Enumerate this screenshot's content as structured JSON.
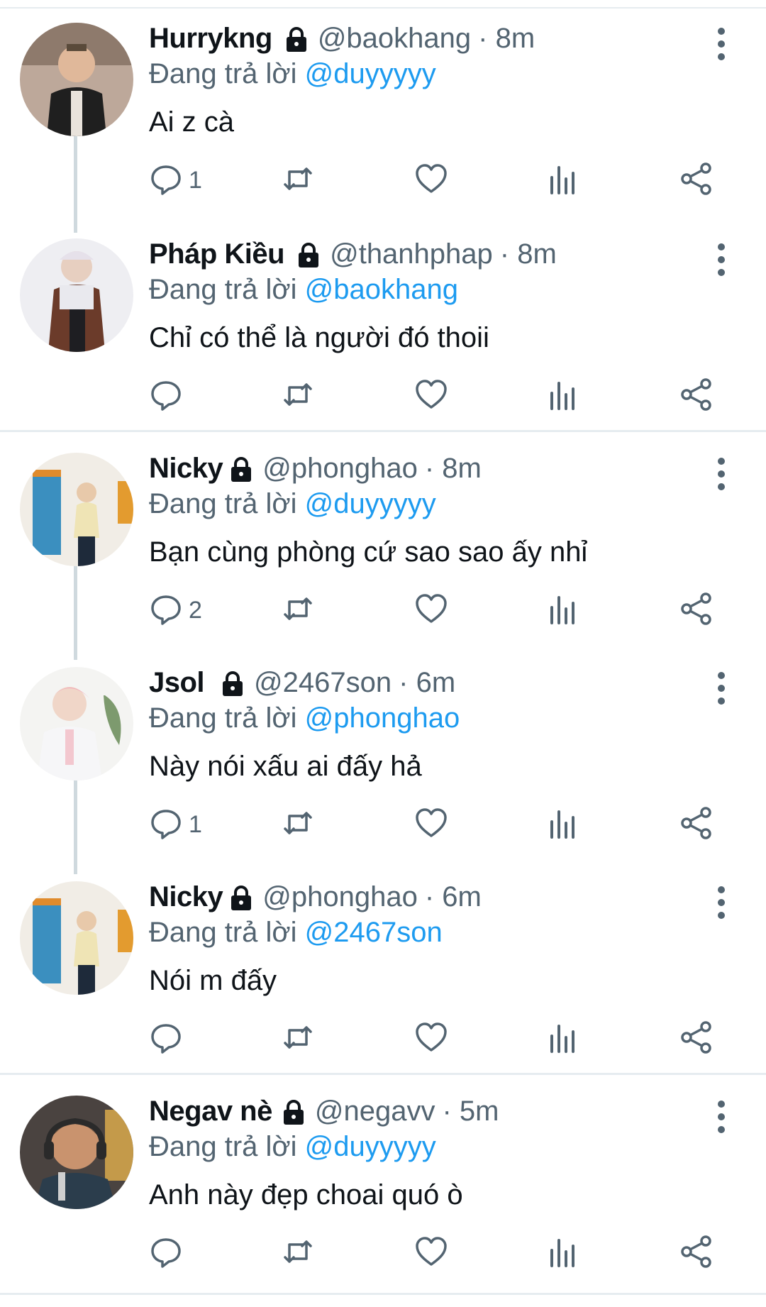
{
  "reply_prefix": "Đang trả lời",
  "icons": {
    "reply": "reply-icon",
    "retweet": "retweet-icon",
    "like": "heart-icon",
    "views": "views-icon",
    "share": "share-icon",
    "more": "more-vertical-icon",
    "protected": "lock-icon"
  },
  "colors": {
    "accent": "#1d9bf0",
    "secondary": "#536471",
    "text": "#0f1419"
  },
  "tweets": [
    {
      "name": "Hurrykng",
      "handle": "@baokhang",
      "time": "· 8m",
      "reply_to": "@duyyyyy",
      "text": "Ai z cà",
      "reply_count": "1"
    },
    {
      "name": "Pháp Kiều",
      "handle": "@thanhphap",
      "time": "· 8m",
      "reply_to": "@baokhang",
      "text": "Chỉ có thể là người đó thoii",
      "reply_count": ""
    },
    {
      "name": "Nicky",
      "handle": "@phonghao",
      "time": "· 8m",
      "reply_to": "@duyyyyy",
      "text": "Bạn cùng phòng cứ sao sao ấy nhỉ",
      "reply_count": "2"
    },
    {
      "name": "Jsol",
      "handle": "@2467son",
      "time": "· 6m",
      "reply_to": "@phonghao",
      "text": "Này nói xấu ai đấy hả",
      "reply_count": "1"
    },
    {
      "name": "Nicky",
      "handle": "@phonghao",
      "time": "· 6m",
      "reply_to": "@2467son",
      "text": "Nói m đấy",
      "reply_count": ""
    },
    {
      "name": "Negav nè",
      "handle": "@negavv",
      "time": "· 5m",
      "reply_to": "@duyyyyy",
      "text": "Anh này đẹp choai quó ò",
      "reply_count": ""
    }
  ]
}
